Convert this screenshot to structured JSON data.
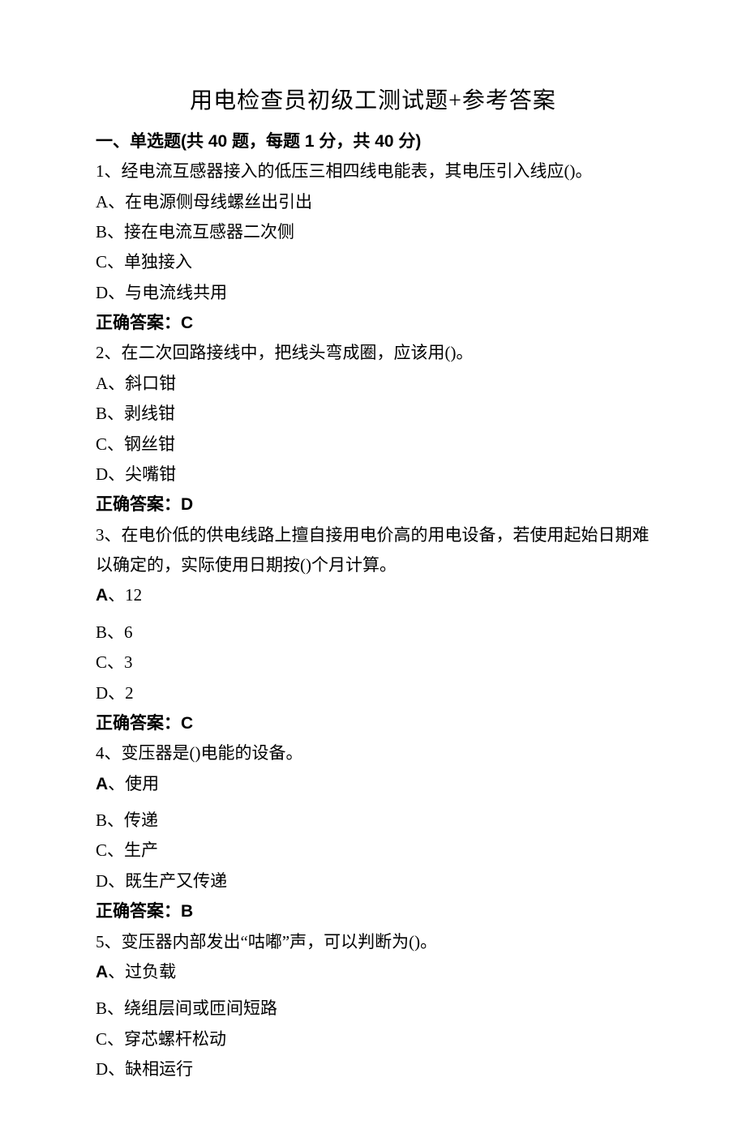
{
  "title": "用电检查员初级工测试题+参考答案",
  "section1_header": "一、单选题(共 40 题，每题 1 分，共 40 分)",
  "q1": {
    "stem": "1、经电流互感器接入的低压三相四线电能表，其电压引入线应()。",
    "A": "A、在电源侧母线螺丝出引出",
    "B": "B、接在电流互感器二次侧",
    "C": "C、单独接入",
    "D": "D、与电流线共用",
    "ans": "正确答案：C"
  },
  "q2": {
    "stem": "2、在二次回路接线中，把线头弯成圈，应该用()。",
    "A": "A、斜口钳",
    "B": "B、剥线钳",
    "C": "C、钢丝钳",
    "D": "D、尖嘴钳",
    "ans": "正确答案：D"
  },
  "q3": {
    "stem": "3、在电价低的供电线路上擅自接用电价高的用电设备，若使用起始日期难以确定的，实际使用日期按()个月计算。",
    "A_label": "A",
    "A_rest": "、12",
    "B": "B、6",
    "C": "C、3",
    "D": "D、2",
    "ans": "正确答案：C"
  },
  "q4": {
    "stem": "4、变压器是()电能的设备。",
    "A_label": "A",
    "A_rest": "、使用",
    "B": "B、传递",
    "C": "C、生产",
    "D": "D、既生产又传递",
    "ans": "正确答案：B"
  },
  "q5": {
    "stem": "5、变压器内部发出“咕嘟”声，可以判断为()。",
    "A_label": "A",
    "A_rest": "、过负载",
    "B": "B、绕组层间或匝间短路",
    "C": "C、穿芯螺杆松动",
    "D": "D、缺相运行"
  }
}
